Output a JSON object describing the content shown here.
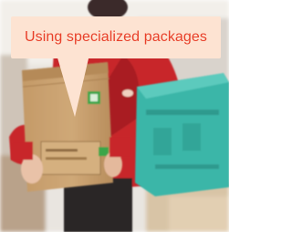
{
  "caption": {
    "text": "Using specialized packages",
    "text_color": "#e8402a",
    "bubble_color": "#fde3d2"
  },
  "scene": {
    "package_color": "#c79e6b",
    "jacket_color": "#c8282c",
    "crate_color": "#3bb6a8"
  }
}
